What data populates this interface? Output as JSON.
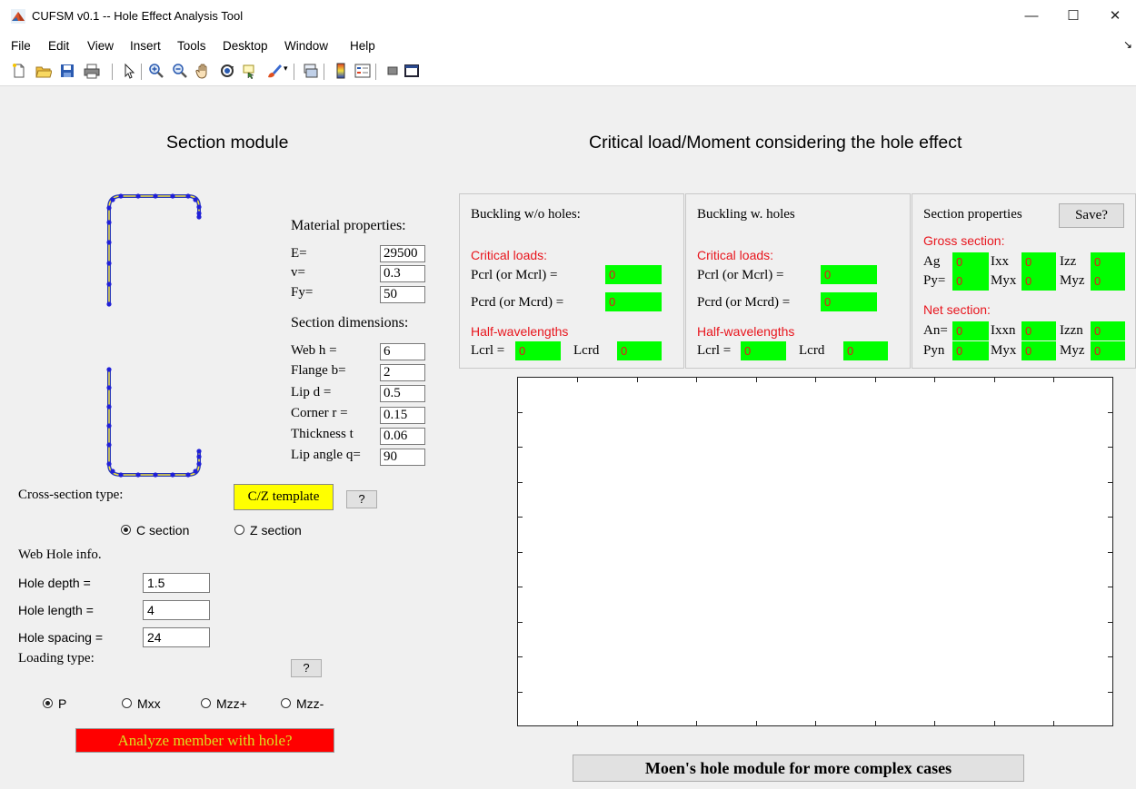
{
  "window": {
    "title": "CUFSM v0.1 -- Hole Effect Analysis Tool",
    "minimize": "—",
    "maximize": "☐",
    "close": "✕"
  },
  "menu": [
    "File",
    "Edit",
    "View",
    "Insert",
    "Tools",
    "Desktop",
    "Window",
    "Help"
  ],
  "menu_overflow": "↘",
  "toolbar": {
    "icons": [
      "new-file-icon",
      "open-folder-icon",
      "save-icon",
      "print-icon",
      "pointer-icon",
      "zoom-in-icon",
      "zoom-out-icon",
      "pan-hand-icon",
      "rotate-3d-icon",
      "data-cursor-icon",
      "brush-icon",
      "dropdown-arrow-icon",
      "link-plot-icon",
      "colorbar-icon",
      "legend-icon",
      "hide-plot-tools-icon",
      "show-plot-tools-icon"
    ]
  },
  "section": {
    "heading": "Section module",
    "material_heading": "Material properties:",
    "E_label": "E=",
    "E_value": "29500",
    "v_label": "v=",
    "v_value": "0.3",
    "Fy_label": "Fy=",
    "Fy_value": "50",
    "dims_heading": "Section dimensions:",
    "web_label": "Web h =",
    "web_value": "6",
    "flange_label": "Flange b=",
    "flange_value": "2",
    "lip_label": "Lip d =",
    "lip_value": "0.5",
    "corner_label": "Corner r =",
    "corner_value": "0.15",
    "thickness_label": "Thickness t",
    "thickness_value": "0.06",
    "lipangle_label": "Lip angle q=",
    "lipangle_value": "90",
    "cross_section_label": "Cross-section type:",
    "template_button": "C/Z template",
    "help_button": "?",
    "c_section": "C section",
    "z_section": "Z section",
    "selected_section": "C section",
    "web_hole_heading": "Web Hole info.",
    "hole_depth_label": "Hole depth =",
    "hole_depth_value": "1.5",
    "hole_length_label": "Hole length =",
    "hole_length_value": "4",
    "hole_spacing_label": "Hole spacing =",
    "hole_spacing_value": "24",
    "loading_label": "Loading type:",
    "loading_help": "?",
    "loading_options": [
      "P",
      "Mxx",
      "Mzz+",
      "Mzz-"
    ],
    "selected_loading": "P",
    "analyze_button": "Analyze member with hole?"
  },
  "critical": {
    "heading": "Critical load/Moment considering the hole effect",
    "without": {
      "title": "Buckling w/o holes:",
      "critical_loads": "Critical loads:",
      "pcrl_label": "Pcrl (or Mcrl) =",
      "pcrl_value": "0",
      "pcrd_label": "Pcrd (or Mcrd) =",
      "pcrd_value": "0",
      "half": "Half-wavelengths",
      "lcrl_label": "Lcrl =",
      "lcrl_value": "0",
      "lcrd_label": "Lcrd",
      "lcrd_value": "0"
    },
    "with": {
      "title": "Buckling w. holes",
      "critical_loads": "Critical loads:",
      "pcrl_label": "Pcrl (or Mcrl) =",
      "pcrl_value": "0",
      "pcrd_label": "Pcrd (or Mcrd) =",
      "pcrd_value": "0",
      "half": "Half-wavelengths",
      "lcrl_label": "Lcrl =",
      "lcrl_value": "0",
      "lcrd_label": "Lcrd",
      "lcrd_value": "0"
    },
    "props": {
      "title": "Section properties",
      "save_button": "Save?",
      "gross": "Gross section:",
      "ag_label": "Ag",
      "ag_value": "0",
      "ixx_label": "Ixx",
      "ixx_value": "0",
      "izz_label": "Izz",
      "izz_value": "0",
      "py_label": "Py=",
      "py_value": "0",
      "myx_label": "Myx",
      "myx_value": "0",
      "myz_label": "Myz",
      "myz_value": "0",
      "net": "Net section:",
      "an_label": "An=",
      "an_value": "0",
      "ixxn_label": "Ixxn",
      "ixxn_value": "0",
      "izzn_label": "Izzn",
      "izzn_value": "0",
      "pyn_label": "Pyn",
      "pyn_value": "0",
      "myxn_label": "Myx",
      "myxn_value": "0",
      "myzn_label": "Myz",
      "myzn_value": "0"
    },
    "moen_button": "Moen's hole module for more complex cases"
  }
}
